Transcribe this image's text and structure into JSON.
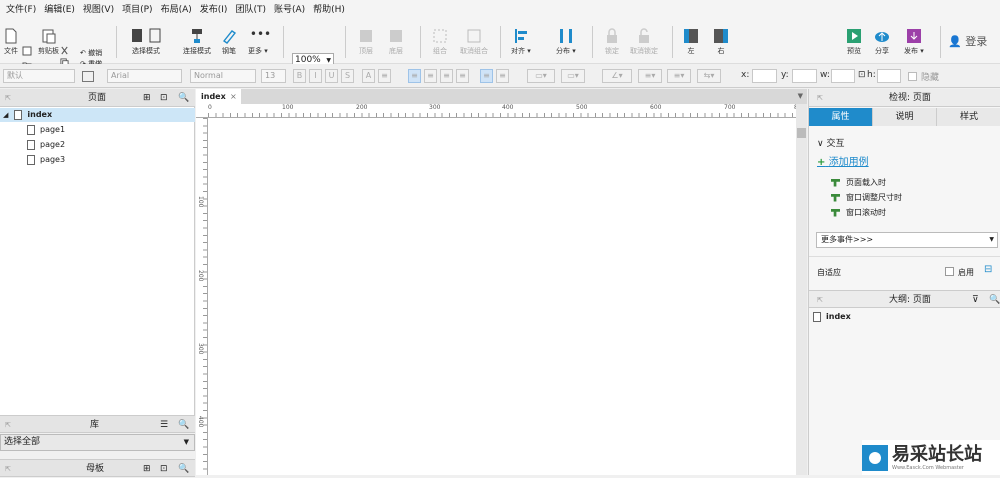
{
  "menu": [
    "文件(F)",
    "编辑(E)",
    "视图(V)",
    "项目(P)",
    "布局(A)",
    "发布(I)",
    "团队(T)",
    "账号(A)",
    "帮助(H)"
  ],
  "toolbar": {
    "file": "文件",
    "clipboard": "剪贴板",
    "undo": "撤销",
    "redo": "重做",
    "select_mode": "选择模式",
    "connect_mode": "连接模式",
    "pen": "钢笔",
    "more": "更多 ▾",
    "zoom_value": "100%",
    "zoom_label": "缩放",
    "top": "顶层",
    "bottom": "底层",
    "group": "组合",
    "ungroup": "取消组合",
    "align": "对齐 ▾",
    "distribute": "分布 ▾",
    "lock": "锁定",
    "unlock": "取消锁定",
    "left": "左",
    "right": "右",
    "preview": "预览",
    "share": "分享",
    "publish": "发布 ▾",
    "login": "登录"
  },
  "format": {
    "style": "默认",
    "font": "Arial",
    "weight": "Normal",
    "size": "13",
    "bold": "B",
    "italic": "I",
    "underline": "U",
    "strike": "S",
    "x": "x:",
    "y": "y:",
    "w": "w:",
    "h": "h:",
    "hidden": "隐藏"
  },
  "pages_panel": {
    "title": "页面",
    "items": [
      "index",
      "page1",
      "page2",
      "page3"
    ]
  },
  "library_panel": {
    "title": "库",
    "select": "选择全部"
  },
  "master_panel": {
    "title": "母板"
  },
  "canvas": {
    "tab": "index",
    "hticks": [
      "0",
      "100",
      "200",
      "300",
      "400",
      "500",
      "600",
      "700",
      "80"
    ],
    "vticks": [
      "100",
      "200",
      "300",
      "400"
    ]
  },
  "inspector": {
    "title": "检视: 页面",
    "tabs": [
      "属性",
      "说明",
      "样式"
    ],
    "section": "交互",
    "add_case": "添加用例",
    "events": [
      "页面载入时",
      "窗口调整尺寸时",
      "窗口滚动时"
    ],
    "more_events": "更多事件>>>",
    "adaptive": "自适应",
    "enable": "启用"
  },
  "outline": {
    "title": "大纲: 页面",
    "item": "index"
  },
  "watermark": {
    "text": "易采站长站",
    "sub": "Www.Easck.Com Webmaster"
  },
  "colors": {
    "accent": "#1f8bcb",
    "selected_row": "#cde6f7"
  }
}
